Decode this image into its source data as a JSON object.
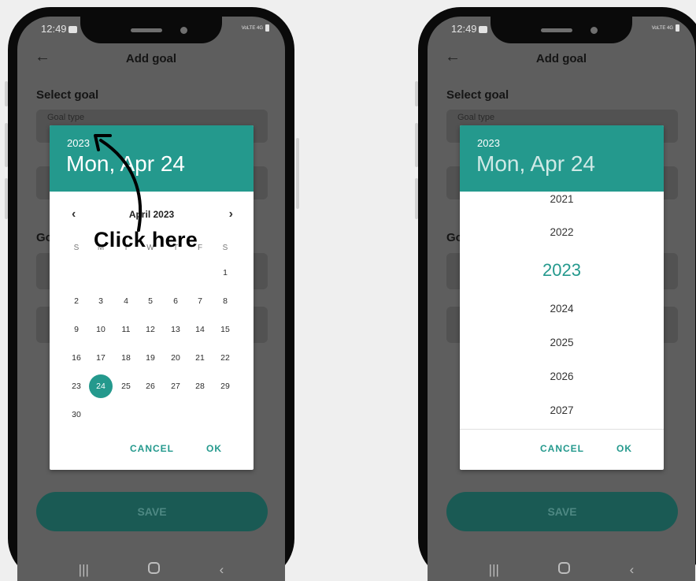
{
  "annotation": {
    "text": "Click here"
  },
  "left": {
    "status_time": "12:49",
    "status_signal": "VoLTE 4G",
    "app_title": "Add goal",
    "section_select": "Select goal",
    "goal_type_label": "Goal type",
    "section_goal_partial": "Go",
    "save_label": "SAVE",
    "dialog": {
      "year": "2023",
      "date": "Mon, Apr 24",
      "month_label": "April 2023",
      "weekdays": [
        "S",
        "M",
        "T",
        "W",
        "T",
        "F",
        "S"
      ],
      "days": [
        "1",
        "2",
        "3",
        "4",
        "5",
        "6",
        "7",
        "8",
        "9",
        "10",
        "11",
        "12",
        "13",
        "14",
        "15",
        "16",
        "17",
        "18",
        "19",
        "20",
        "21",
        "22",
        "23",
        "24",
        "25",
        "26",
        "27",
        "28",
        "29",
        "30"
      ],
      "selected_day": "24",
      "cancel": "CANCEL",
      "ok": "OK"
    }
  },
  "right": {
    "status_time": "12:49",
    "status_signal": "VoLTE 4G",
    "app_title": "Add goal",
    "section_select": "Select goal",
    "goal_type_label": "Goal type",
    "section_goal_partial": "Go",
    "save_label": "SAVE",
    "dialog": {
      "year": "2023",
      "date": "Mon, Apr 24",
      "years": [
        "2021",
        "2022",
        "2023",
        "2024",
        "2025",
        "2026",
        "2027"
      ],
      "selected_year": "2023",
      "cancel": "CANCEL",
      "ok": "OK"
    }
  },
  "colors": {
    "accent": "#24998d",
    "save_button": "#1a5a54",
    "phone_body": "#0a0a0a"
  },
  "icons": [
    "back-arrow-icon",
    "chevron-left-icon",
    "chevron-right-icon",
    "nav-recents-icon",
    "nav-home-icon",
    "nav-back-icon"
  ]
}
